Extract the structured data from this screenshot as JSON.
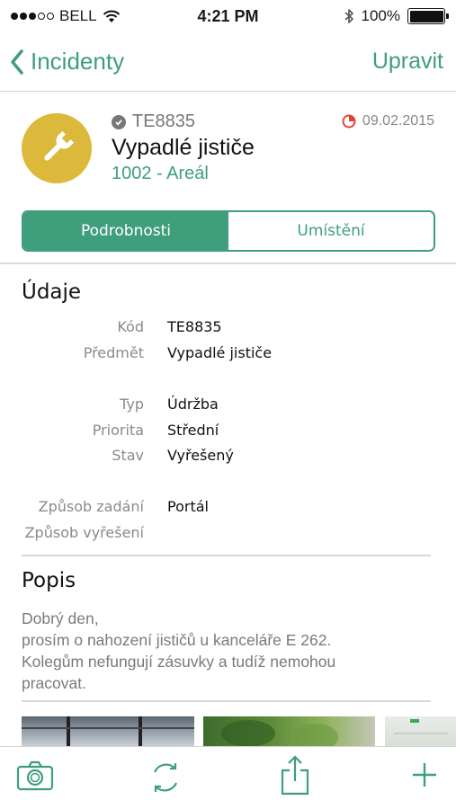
{
  "status_bar": {
    "carrier": "BELL",
    "time": "4:21 PM",
    "battery": "100%"
  },
  "nav": {
    "back_label": "Incidenty",
    "edit_label": "Upravit"
  },
  "incident": {
    "code": "TE8835",
    "title": "Vypadlé jističe",
    "location": "1002 - Areál",
    "date": "09.02.2015",
    "icon": "wrench-icon",
    "avatar_color": "#dcb93a"
  },
  "tabs": [
    {
      "label": "Podrobnosti",
      "active": true
    },
    {
      "label": "Umístění",
      "active": false
    }
  ],
  "details": {
    "section_title": "Údaje",
    "fields": [
      {
        "label": "Kód",
        "value": "TE8835"
      },
      {
        "label": "Předmět",
        "value": "Vypadlé jističe"
      },
      {
        "label": "Typ",
        "value": "Údržba"
      },
      {
        "label": "Priorita",
        "value": "Střední"
      },
      {
        "label": "Stav",
        "value": "Vyřešený"
      },
      {
        "label": "Způsob zadání",
        "value": "Portál"
      },
      {
        "label": "Způsob vyřešení",
        "value": ""
      }
    ]
  },
  "description": {
    "section_title": "Popis",
    "lines": [
      "Dobrý den,",
      "prosím o nahození jističů u kanceláře E 262.",
      "Kolegům nefungují zásuvky a tudíž nemohou",
      "pracovat."
    ]
  },
  "toolbar": {
    "icons": [
      "camera-icon",
      "refresh-icon",
      "share-icon",
      "plus-icon"
    ]
  },
  "colors": {
    "accent": "#3f9e7c",
    "secondary_text": "#8a8a8a",
    "date_icon": "#e0433a"
  }
}
